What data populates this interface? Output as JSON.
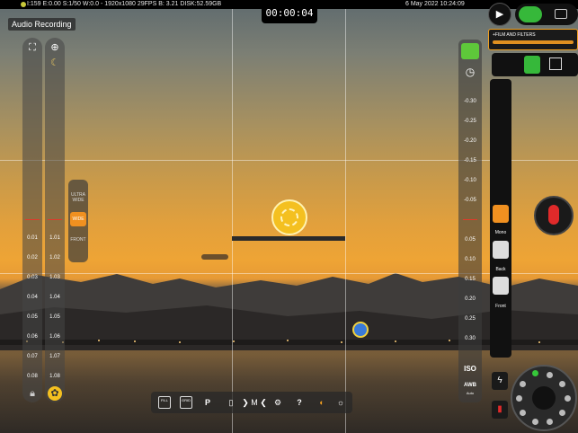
{
  "status_bar": {
    "left": "I:159 E:0.00 S:1/50 W:0.0 - 1920x1080 29FPS B: 3.21 DISK:52.59GB",
    "right": "6 May 2022 10:24:09"
  },
  "timer": "00:00:04",
  "audio_label": "Audio Recording",
  "zoom_scale": [
    "0.01",
    "0.02",
    "0.03",
    "0.04",
    "0.05",
    "0.06",
    "0.07",
    "0.08"
  ],
  "focus_scale": [
    "1.01",
    "1.02",
    "1.03",
    "1.04",
    "1.05",
    "1.06",
    "1.07",
    "1.08"
  ],
  "lens": {
    "ultra": "ULTRA WIDE",
    "wide": "WIDE",
    "front": "FRONT"
  },
  "ev_scale": [
    "-0.30",
    "-0.25",
    "-0.20",
    "-0.15",
    "-0.10",
    "-0.05",
    "0.05",
    "0.10",
    "0.15",
    "0.20",
    "0.25",
    "0.30"
  ],
  "iso_label": "ISO",
  "awb_label": "AWB",
  "awb_sub": "Auto",
  "film_filters": "+FILM AND FILTERS",
  "audio_modes": {
    "mono": "Mono",
    "back": "Back",
    "front": "Front"
  },
  "toolbar": {
    "fill": "FILL",
    "grid": "GRID",
    "p": "P",
    "m": "M",
    "help": "?"
  },
  "colors": {
    "accent": "#f09020",
    "active_green": "#36b83a",
    "record_red": "#e02a2a",
    "focus_yellow": "#f4c020"
  }
}
